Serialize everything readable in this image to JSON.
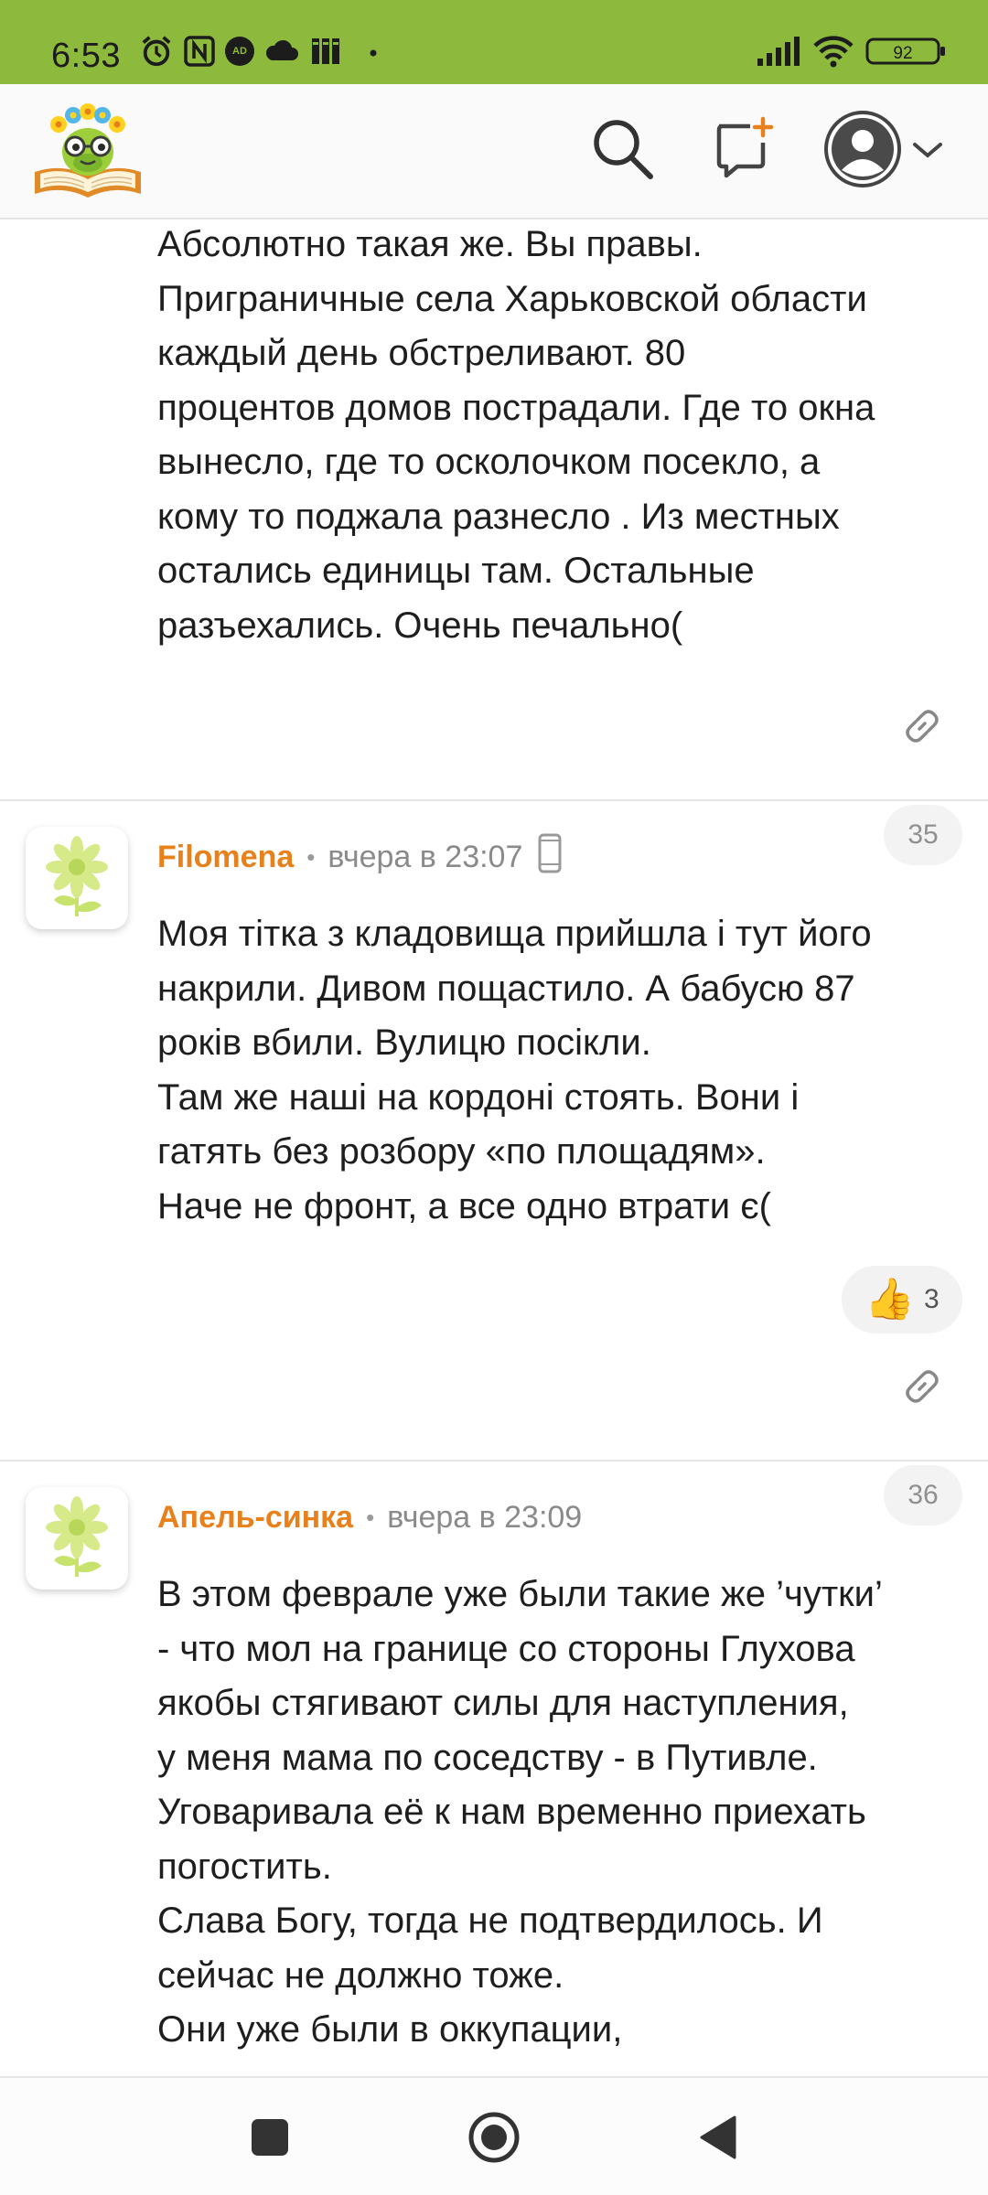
{
  "status_bar": {
    "time": "6:53",
    "battery": "92",
    "icons": [
      "alarm-icon",
      "nfc-icon",
      "ad-blocker-icon",
      "cloud-icon",
      "library-icon",
      "dot-icon",
      "signal-icon",
      "wifi-icon",
      "battery-icon"
    ],
    "bg_color": "#8dba3d"
  },
  "header": {
    "logo": "site-logo",
    "icons": [
      "search-icon",
      "new-message-icon",
      "profile-icon",
      "chevron-down-icon"
    ],
    "accent_color": "#e8801c"
  },
  "comments": [
    {
      "text": "Абсолютно такая же. Вы правы.\nПриграничные села Харьковской области\nкаждый день обстреливают. 80\nпроцентов домов пострадали. Где то окна\nвынесло, где то осколочком посекло, а\nкому то поджала разнесло . Из местных\nостались единицы там. Остальные\nразъехались. Очень печально("
    },
    {
      "author": "Filomena",
      "time": "вчера в 23:07",
      "number": "35",
      "device": "mobile-phone-icon",
      "text": "Моя тітка з кладовища прийшла і тут його\nнакрили. Дивом пощастило. А бабусю 87\nроків вбили. Вулицю посікли.\nТам же наші на кордоні стоять. Вони і\nгатять без розбору «по площадям».\nНаче не фронт, а все одно втрати є(",
      "likes": "3"
    },
    {
      "author": "Апель-синка",
      "time": "вчера в 23:09",
      "number": "36",
      "text": "В этом феврале уже были такие же ’чутки’\n- что мол на границе со стороны Глухова\nякобы стягивают силы для наступления,\nу меня мама по соседству - в Путивле.\nУговаривала её к нам временно приехать\nпогостить.\nСлава Богу, тогда не подтвердилось. И\nсейчас не должно тоже.\nОни уже были в оккупации,"
    }
  ],
  "nav_bar": {
    "icons": [
      "recents-icon",
      "home-icon",
      "back-icon"
    ]
  }
}
